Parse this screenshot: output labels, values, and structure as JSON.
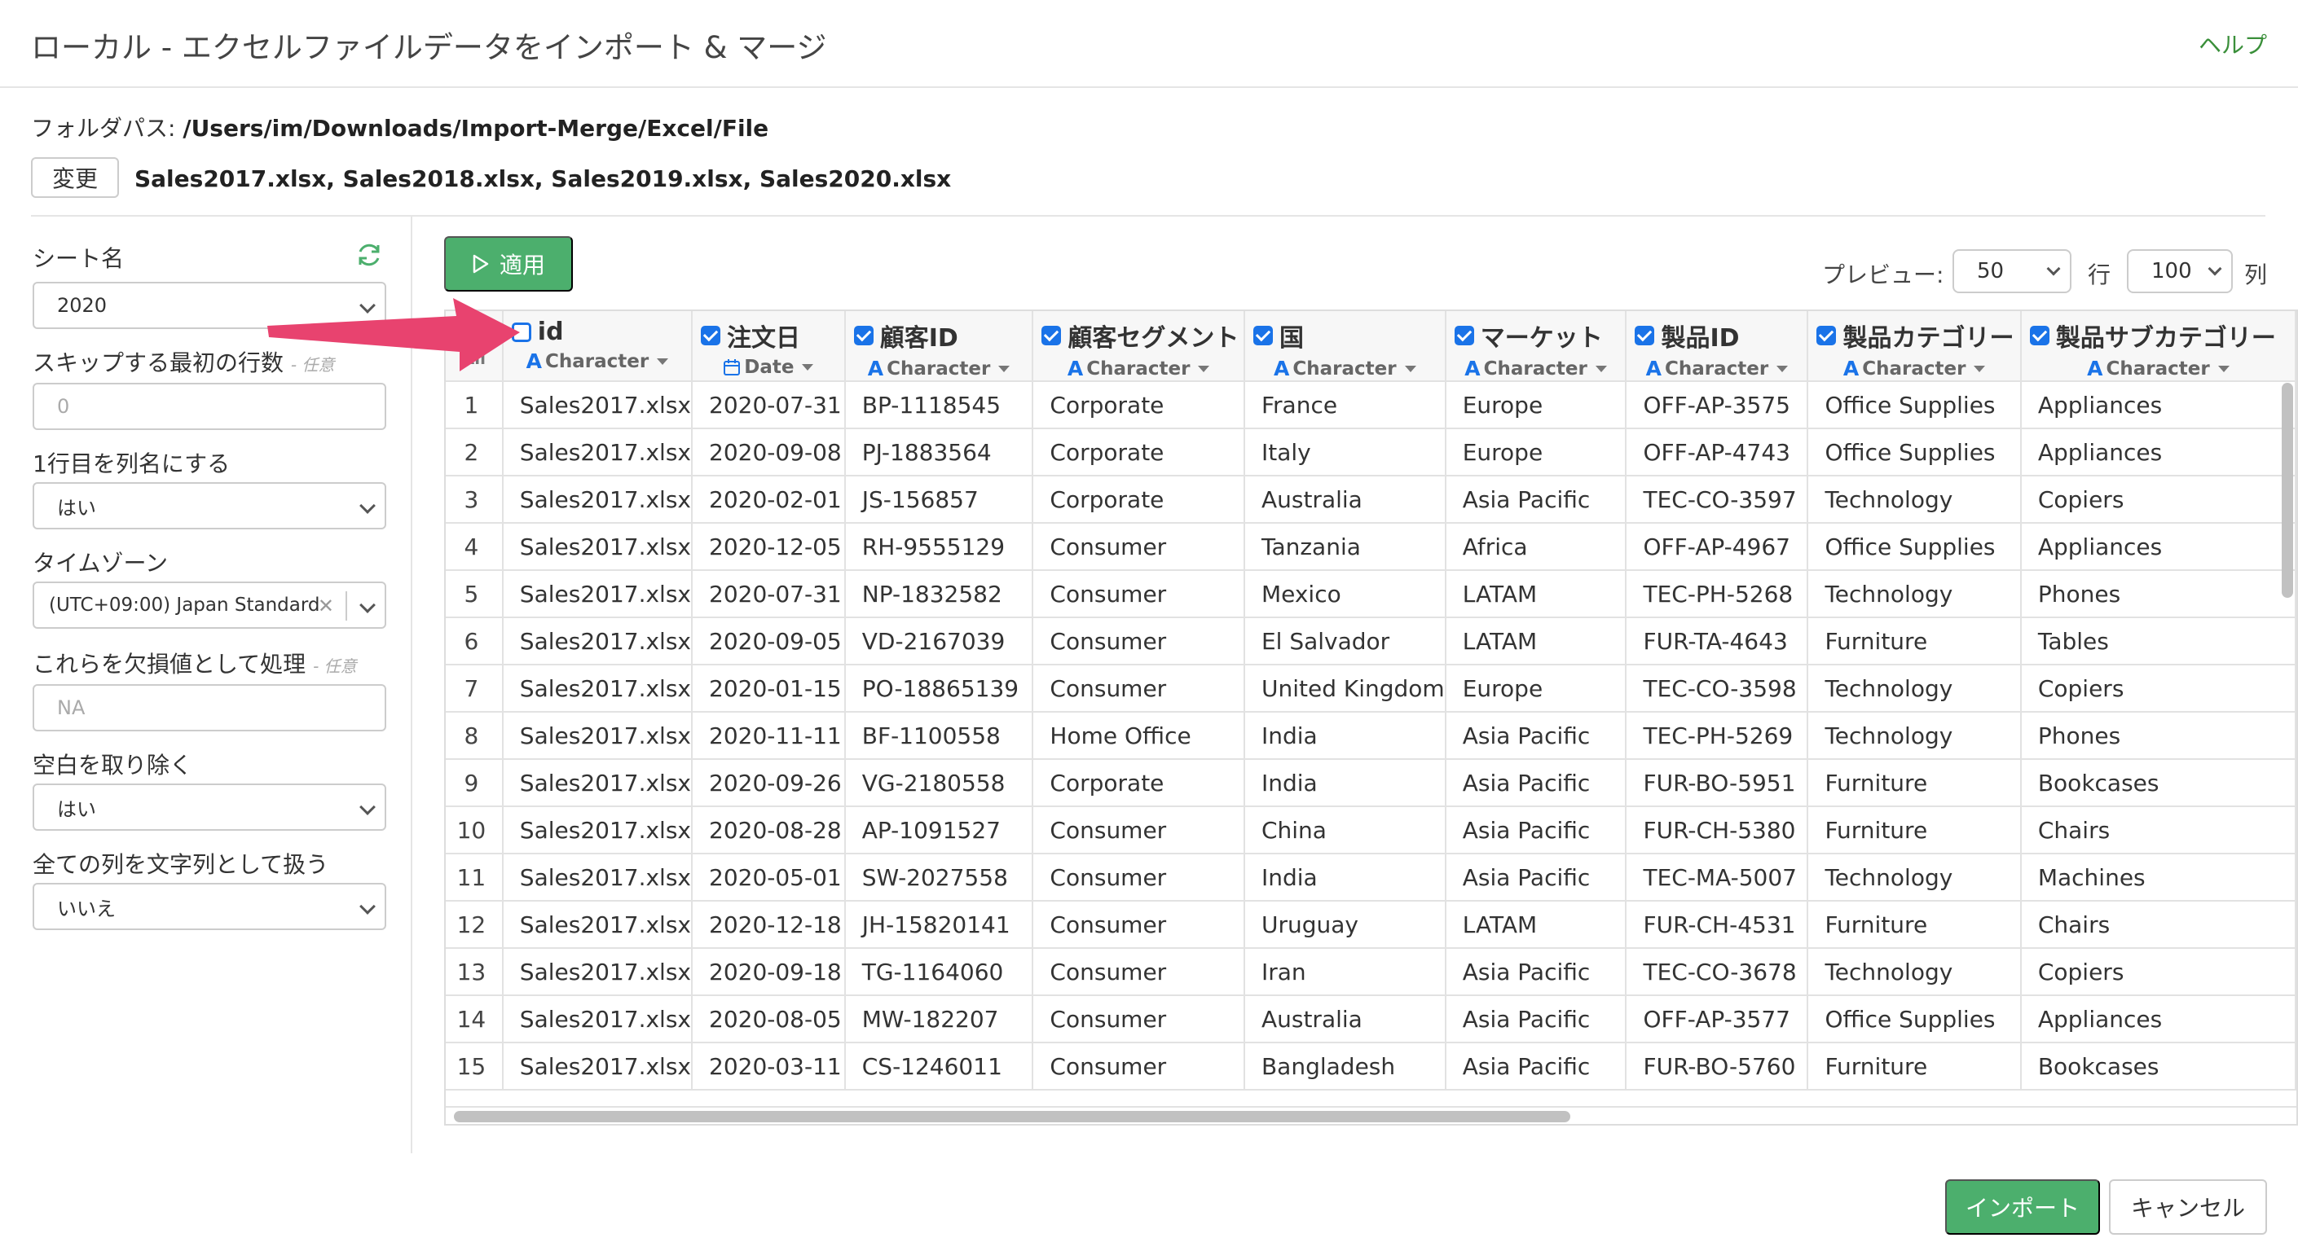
{
  "header": {
    "title": "ローカル - エクセルファイルデータをインポート & マージ",
    "help": "ヘルプ"
  },
  "path": {
    "label": "フォルダパス: ",
    "value": "/Users/im/Downloads/Import-Merge/Excel/File"
  },
  "change_button": "変更",
  "files": "Sales2017.xlsx, Sales2018.xlsx, Sales2019.xlsx, Sales2020.xlsx",
  "sidebar": {
    "sheet_label": "シート名",
    "sheet_value": "2020",
    "skip_label": "スキップする最初の行数",
    "skip_optional": "- 任意",
    "skip_placeholder": "0",
    "header_row_label": "1行目を列名にする",
    "header_row_value": "はい",
    "timezone_label": "タイムゾーン",
    "timezone_value": "(UTC+09:00) Japan Standard",
    "na_label": "これらを欠損値として処理",
    "na_optional": "- 任意",
    "na_placeholder": "NA",
    "trim_label": "空白を取り除く",
    "trim_value": "はい",
    "as_char_label": "全ての列を文字列として扱う",
    "as_char_value": "いいえ"
  },
  "apply_button": "適用",
  "preview": {
    "label": "プレビュー:",
    "rows_value": "50",
    "rows_unit": "行",
    "cols_value": "100",
    "cols_unit": "列"
  },
  "grid": {
    "all_label": "All",
    "columns": [
      {
        "name": "id",
        "type": "Character",
        "type_icon": "A",
        "checked": false
      },
      {
        "name": "注文日",
        "type": "Date",
        "type_icon": "calendar-icon",
        "checked": true
      },
      {
        "name": "顧客ID",
        "type": "Character",
        "type_icon": "A",
        "checked": true
      },
      {
        "name": "顧客セグメント",
        "type": "Character",
        "type_icon": "A",
        "checked": true
      },
      {
        "name": "国",
        "type": "Character",
        "type_icon": "A",
        "checked": true
      },
      {
        "name": "マーケット",
        "type": "Character",
        "type_icon": "A",
        "checked": true
      },
      {
        "name": "製品ID",
        "type": "Character",
        "type_icon": "A",
        "checked": true
      },
      {
        "name": "製品カテゴリー",
        "type": "Character",
        "type_icon": "A",
        "checked": true
      },
      {
        "name": "製品サブカテゴリー",
        "type": "Character",
        "type_icon": "A",
        "checked": true
      }
    ],
    "rows": [
      [
        "1",
        "Sales2017.xlsx",
        "2020-07-31",
        "BP-1118545",
        "Corporate",
        "France",
        "Europe",
        "OFF-AP-3575",
        "Office Supplies",
        "Appliances"
      ],
      [
        "2",
        "Sales2017.xlsx",
        "2020-09-08",
        "PJ-1883564",
        "Corporate",
        "Italy",
        "Europe",
        "OFF-AP-4743",
        "Office Supplies",
        "Appliances"
      ],
      [
        "3",
        "Sales2017.xlsx",
        "2020-02-01",
        "JS-156857",
        "Corporate",
        "Australia",
        "Asia Pacific",
        "TEC-CO-3597",
        "Technology",
        "Copiers"
      ],
      [
        "4",
        "Sales2017.xlsx",
        "2020-12-05",
        "RH-9555129",
        "Consumer",
        "Tanzania",
        "Africa",
        "OFF-AP-4967",
        "Office Supplies",
        "Appliances"
      ],
      [
        "5",
        "Sales2017.xlsx",
        "2020-07-31",
        "NP-1832582",
        "Consumer",
        "Mexico",
        "LATAM",
        "TEC-PH-5268",
        "Technology",
        "Phones"
      ],
      [
        "6",
        "Sales2017.xlsx",
        "2020-09-05",
        "VD-2167039",
        "Consumer",
        "El Salvador",
        "LATAM",
        "FUR-TA-4643",
        "Furniture",
        "Tables"
      ],
      [
        "7",
        "Sales2017.xlsx",
        "2020-01-15",
        "PO-18865139",
        "Consumer",
        "United Kingdom",
        "Europe",
        "TEC-CO-3598",
        "Technology",
        "Copiers"
      ],
      [
        "8",
        "Sales2017.xlsx",
        "2020-11-11",
        "BF-1100558",
        "Home Office",
        "India",
        "Asia Pacific",
        "TEC-PH-5269",
        "Technology",
        "Phones"
      ],
      [
        "9",
        "Sales2017.xlsx",
        "2020-09-26",
        "VG-2180558",
        "Corporate",
        "India",
        "Asia Pacific",
        "FUR-BO-5951",
        "Furniture",
        "Bookcases"
      ],
      [
        "10",
        "Sales2017.xlsx",
        "2020-08-28",
        "AP-1091527",
        "Consumer",
        "China",
        "Asia Pacific",
        "FUR-CH-5380",
        "Furniture",
        "Chairs"
      ],
      [
        "11",
        "Sales2017.xlsx",
        "2020-05-01",
        "SW-2027558",
        "Consumer",
        "India",
        "Asia Pacific",
        "TEC-MA-5007",
        "Technology",
        "Machines"
      ],
      [
        "12",
        "Sales2017.xlsx",
        "2020-12-18",
        "JH-15820141",
        "Consumer",
        "Uruguay",
        "LATAM",
        "FUR-CH-4531",
        "Furniture",
        "Chairs"
      ],
      [
        "13",
        "Sales2017.xlsx",
        "2020-09-18",
        "TG-1164060",
        "Consumer",
        "Iran",
        "Asia Pacific",
        "TEC-CO-3678",
        "Technology",
        "Copiers"
      ],
      [
        "14",
        "Sales2017.xlsx",
        "2020-08-05",
        "MW-182207",
        "Consumer",
        "Australia",
        "Asia Pacific",
        "OFF-AP-3577",
        "Office Supplies",
        "Appliances"
      ],
      [
        "15",
        "Sales2017.xlsx",
        "2020-03-11",
        "CS-1246011",
        "Consumer",
        "Bangladesh",
        "Asia Pacific",
        "FUR-BO-5760",
        "Furniture",
        "Bookcases"
      ]
    ]
  },
  "footer": {
    "import_button": "インポート",
    "cancel_button": "キャンセル"
  },
  "colors": {
    "accent_green": "#4caf6d",
    "checkbox_blue": "#1a73e8",
    "arrow_pink": "#e8436f",
    "help_green": "#3a8f3a"
  }
}
